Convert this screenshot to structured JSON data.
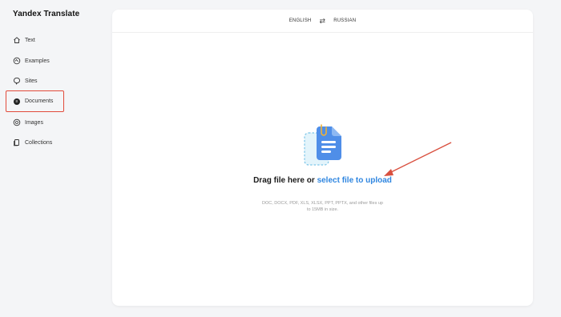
{
  "app": {
    "title": "Yandex Translate"
  },
  "sidebar": {
    "items": [
      {
        "label": "Text",
        "icon": "home-icon"
      },
      {
        "label": "Examples",
        "icon": "examples-icon"
      },
      {
        "label": "Sites",
        "icon": "sites-icon"
      },
      {
        "label": "Documents",
        "icon": "documents-icon",
        "active": true
      },
      {
        "label": "Images",
        "icon": "images-icon"
      },
      {
        "label": "Collections",
        "icon": "collections-icon"
      }
    ]
  },
  "langbar": {
    "source": "ENGLISH",
    "swap_icon": "swap-icon",
    "target": "RUSSIAN"
  },
  "upload": {
    "drag_text": "Drag file here or",
    "link_text": "select file to upload",
    "hint": "DOC, DOCX, PDF, XLS, XLSX, PPT, PPTX, and other files up to 15MB in size."
  },
  "colors": {
    "accent": "#2f86e0",
    "highlight": "#e24b3b"
  }
}
